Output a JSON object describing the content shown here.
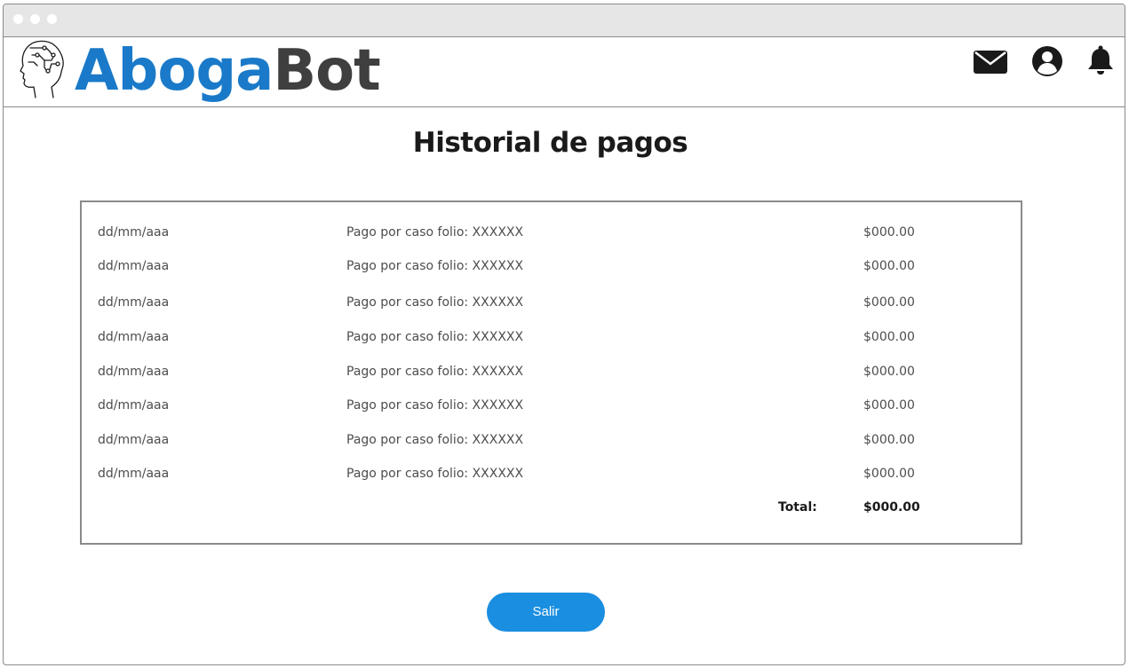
{
  "brand": {
    "part1": "Aboga",
    "part2": "Bot",
    "color_part1": "#1a7ac9",
    "color_part2": "#3f3f3f"
  },
  "header_icons": [
    "mail-icon",
    "user-account-icon",
    "bell-icon"
  ],
  "page": {
    "title": "Historial de pagos"
  },
  "payments": {
    "rows": [
      {
        "date": "dd/mm/aaa",
        "description": "Pago por caso folio: XXXXXX",
        "amount": "$000.00"
      },
      {
        "date": "dd/mm/aaa",
        "description": "Pago por caso folio: XXXXXX",
        "amount": "$000.00"
      },
      {
        "date": "dd/mm/aaa",
        "description": "Pago por caso folio: XXXXXX",
        "amount": "$000.00"
      },
      {
        "date": "dd/mm/aaa",
        "description": "Pago por caso folio: XXXXXX",
        "amount": "$000.00"
      },
      {
        "date": "dd/mm/aaa",
        "description": "Pago por caso folio: XXXXXX",
        "amount": "$000.00"
      },
      {
        "date": "dd/mm/aaa",
        "description": "Pago por caso folio: XXXXXX",
        "amount": "$000.00"
      },
      {
        "date": "dd/mm/aaa",
        "description": "Pago por caso folio: XXXXXX",
        "amount": "$000.00"
      },
      {
        "date": "dd/mm/aaa",
        "description": "Pago por caso folio: XXXXXX",
        "amount": "$000.00"
      }
    ],
    "total_label": "Total:",
    "total_amount": "$000.00"
  },
  "actions": {
    "exit_label": "Salir",
    "exit_color": "#1a8ee0"
  }
}
